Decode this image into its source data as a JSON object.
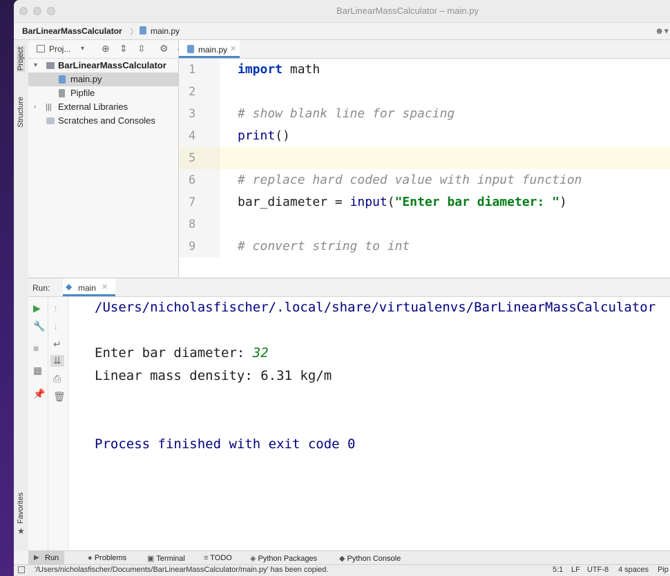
{
  "window": {
    "title": "BarLinearMassCalculator – main.py"
  },
  "navbar": {
    "project": "BarLinearMassCalculator",
    "file": "main.py"
  },
  "left_strip": {
    "project_tab": "Project",
    "structure_tab": "Structure",
    "favorites_tab": "Favorites"
  },
  "project_panel": {
    "selector": "Proj...",
    "tree": [
      {
        "label": "BarLinearMassCalculator",
        "bold": true
      },
      {
        "label": "main.py",
        "selected": true
      },
      {
        "label": "Pipfile"
      },
      {
        "label": "External Libraries"
      },
      {
        "label": "Scratches and Consoles"
      }
    ]
  },
  "editor": {
    "tab_label": "main.py",
    "line_numbers": [
      "1",
      "2",
      "3",
      "4",
      "5",
      "6",
      "7",
      "8",
      "9"
    ],
    "code": {
      "l1_kw": "import",
      "l1_rest": " math",
      "l3_comment": "# show blank line for spacing",
      "l4_fn": "print",
      "l4_rest": "()",
      "l6_comment": "# replace hard coded value with input function",
      "l7_var": "bar_diameter = ",
      "l7_fn": "input",
      "l7_open": "(",
      "l7_str": "\"Enter bar diameter: \"",
      "l7_close": ")",
      "l9_comment": "# convert string to int"
    }
  },
  "run": {
    "label": "Run:",
    "tab": "main",
    "console": {
      "path": "/Users/nicholasfischer/.local/share/virtualenvs/BarLinearMassCalculator",
      "prompt": "Enter bar diameter: ",
      "input": "32",
      "result": "Linear mass density: 6.31 kg/m",
      "finish": "Process finished with exit code 0"
    }
  },
  "bottom_tabs": [
    "Run",
    "Problems",
    "Terminal",
    "TODO",
    "Python Packages",
    "Python Console"
  ],
  "status": {
    "message": "'/Users/nicholasfischer/Documents/BarLinearMassCalculator/main.py' has been copied.",
    "position": "5:1",
    "line_ending": "LF",
    "encoding": "UTF-8",
    "indent": "4 spaces",
    "interpreter": "Pip"
  }
}
